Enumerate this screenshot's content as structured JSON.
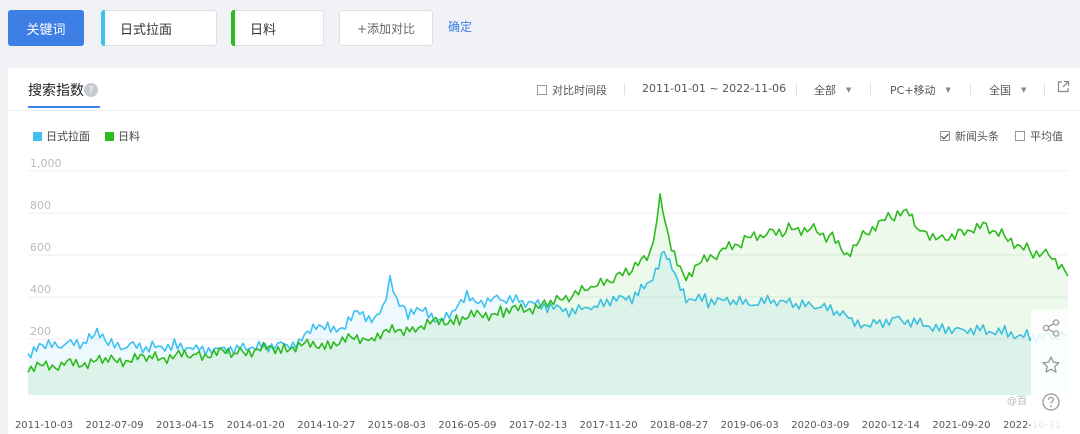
{
  "topbar": {
    "keyword_button": "关键词",
    "terms": [
      {
        "label": "日式拉面",
        "color": "#3ec1f0"
      },
      {
        "label": "日料",
        "color": "#2cba1e"
      }
    ],
    "add_compare": "+添加对比",
    "confirm": "确定"
  },
  "panel": {
    "title": "搜索指数",
    "help": "?",
    "compare_period": "对比时间段",
    "date_range": "2011-01-01 ~ 2022-11-06",
    "channel": "全部",
    "device": "PC+移动",
    "region": "全国",
    "news_headlines": "新闻头条",
    "average": "平均值",
    "watermark": "@百"
  },
  "icons": {
    "external": "external-link-icon",
    "share": "share-icon",
    "star": "star-icon",
    "help": "help-circle-icon"
  },
  "chart_data": {
    "type": "line",
    "ylim": [
      0,
      1000
    ],
    "yticks": [
      200,
      400,
      600,
      800,
      1000
    ],
    "ytick_labels": [
      "200",
      "400",
      "600",
      "800",
      "1,000"
    ],
    "x_tick_labels": [
      "2011-10-03",
      "2012-07-09",
      "2013-04-15",
      "2014-01-20",
      "2014-10-27",
      "2015-08-03",
      "2016-05-09",
      "2017-02-13",
      "2017-11-20",
      "2018-08-27",
      "2019-06-03",
      "2020-03-09",
      "2020-12-14",
      "2021-09-20",
      "2022-10-31"
    ],
    "x_start": "2011-01-01",
    "x_end": "2022-11-06",
    "grid": true,
    "legend": "top-left",
    "series": [
      {
        "name": "日式拉面",
        "color": "#3ec1f0",
        "points": [
          [
            "2011-01-01",
            130
          ],
          [
            "2011-03-01",
            160
          ],
          [
            "2011-06-01",
            170
          ],
          [
            "2011-09-01",
            185
          ],
          [
            "2011-10-15",
            225
          ],
          [
            "2011-12-01",
            170
          ],
          [
            "2012-03-01",
            165
          ],
          [
            "2012-06-01",
            160
          ],
          [
            "2012-09-01",
            175
          ],
          [
            "2012-12-01",
            160
          ],
          [
            "2013-03-01",
            150
          ],
          [
            "2013-06-01",
            165
          ],
          [
            "2013-09-01",
            170
          ],
          [
            "2013-12-01",
            175
          ],
          [
            "2014-02-01",
            185
          ],
          [
            "2014-04-01",
            240
          ],
          [
            "2014-06-01",
            265
          ],
          [
            "2014-08-01",
            250
          ],
          [
            "2014-10-01",
            320
          ],
          [
            "2014-12-01",
            300
          ],
          [
            "2015-01-15",
            350
          ],
          [
            "2015-02-15",
            470
          ],
          [
            "2015-03-15",
            395
          ],
          [
            "2015-05-01",
            320
          ],
          [
            "2015-07-01",
            330
          ],
          [
            "2015-09-01",
            300
          ],
          [
            "2015-11-01",
            310
          ],
          [
            "2016-01-01",
            410
          ],
          [
            "2016-03-01",
            380
          ],
          [
            "2016-06-01",
            390
          ],
          [
            "2016-09-01",
            370
          ],
          [
            "2016-12-01",
            350
          ],
          [
            "2017-03-01",
            330
          ],
          [
            "2017-06-01",
            340
          ],
          [
            "2017-09-01",
            380
          ],
          [
            "2017-12-01",
            400
          ],
          [
            "2018-02-01",
            470
          ],
          [
            "2018-04-01",
            630
          ],
          [
            "2018-05-15",
            520
          ],
          [
            "2018-07-01",
            400
          ],
          [
            "2018-10-01",
            380
          ],
          [
            "2019-01-01",
            375
          ],
          [
            "2019-04-01",
            365
          ],
          [
            "2019-07-01",
            380
          ],
          [
            "2019-10-01",
            360
          ],
          [
            "2020-01-01",
            350
          ],
          [
            "2020-04-01",
            325
          ],
          [
            "2020-06-01",
            270
          ],
          [
            "2020-09-01",
            280
          ],
          [
            "2020-12-01",
            300
          ],
          [
            "2021-03-01",
            275
          ],
          [
            "2021-06-01",
            255
          ],
          [
            "2021-09-01",
            250
          ],
          [
            "2021-12-01",
            245
          ],
          [
            "2022-03-01",
            230
          ],
          [
            "2022-06-01",
            215
          ],
          [
            "2022-09-01",
            210
          ],
          [
            "2022-11-06",
            225
          ]
        ]
      },
      {
        "name": "日料",
        "color": "#2cba1e",
        "points": [
          [
            "2011-01-01",
            60
          ],
          [
            "2011-06-01",
            80
          ],
          [
            "2011-12-01",
            95
          ],
          [
            "2012-06-01",
            110
          ],
          [
            "2012-12-01",
            125
          ],
          [
            "2013-06-01",
            140
          ],
          [
            "2013-12-01",
            160
          ],
          [
            "2014-06-01",
            180
          ],
          [
            "2014-12-01",
            215
          ],
          [
            "2015-06-01",
            260
          ],
          [
            "2015-12-01",
            300
          ],
          [
            "2016-06-01",
            330
          ],
          [
            "2016-12-01",
            360
          ],
          [
            "2017-03-01",
            400
          ],
          [
            "2017-06-01",
            440
          ],
          [
            "2017-09-01",
            480
          ],
          [
            "2017-12-01",
            540
          ],
          [
            "2018-02-01",
            600
          ],
          [
            "2018-03-15",
            860
          ],
          [
            "2018-05-01",
            620
          ],
          [
            "2018-07-01",
            500
          ],
          [
            "2018-09-01",
            560
          ],
          [
            "2018-12-01",
            620
          ],
          [
            "2019-03-01",
            670
          ],
          [
            "2019-06-01",
            700
          ],
          [
            "2019-09-01",
            720
          ],
          [
            "2019-12-01",
            730
          ],
          [
            "2020-03-01",
            680
          ],
          [
            "2020-05-01",
            610
          ],
          [
            "2020-08-01",
            720
          ],
          [
            "2020-11-01",
            780
          ],
          [
            "2021-01-15",
            800
          ],
          [
            "2021-03-01",
            720
          ],
          [
            "2021-06-01",
            680
          ],
          [
            "2021-09-01",
            720
          ],
          [
            "2021-12-01",
            740
          ],
          [
            "2022-03-01",
            680
          ],
          [
            "2022-06-01",
            620
          ],
          [
            "2022-09-01",
            600
          ],
          [
            "2022-11-06",
            500
          ]
        ]
      }
    ]
  }
}
